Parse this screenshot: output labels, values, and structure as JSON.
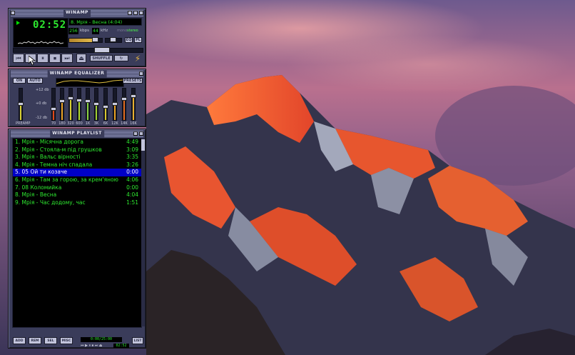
{
  "main": {
    "title": "WINAMP",
    "time": "02:52",
    "song": "8. Мрія - Весна (4:04)",
    "kbps": "256",
    "kbps_unit": "kbps",
    "khz": "44",
    "khz_unit": "kHz",
    "mono": "mono",
    "stereo": "stereo",
    "volume": 0.8,
    "balance": 0.5,
    "seek_position": 0.71,
    "eq_toggle": "EQ",
    "pl_toggle": "PL",
    "shuffle": "SHUFFLE",
    "repeat": "↻",
    "buttons": [
      "⏮",
      "▶",
      "⏸",
      "⏹",
      "⏭",
      "⏏"
    ]
  },
  "equalizer": {
    "title": "WINAMP EQUALIZER",
    "on": "ON",
    "auto": "AUTO",
    "presets": "PRESETS",
    "preamp_label": "PREAMP",
    "db_plus": "+12 db",
    "db_zero": "+0 db",
    "db_minus": "-12 db",
    "bands": [
      "70",
      "180",
      "320",
      "600",
      "1K",
      "3K",
      "6K",
      "12K",
      "14K",
      "16K"
    ],
    "preamp": 0.5,
    "band_levels": [
      0.35,
      0.58,
      0.68,
      0.62,
      0.6,
      0.5,
      0.42,
      0.5,
      0.65,
      0.75
    ]
  },
  "playlist": {
    "title": "WINAMP PLAYLIST",
    "items": [
      {
        "title": "1. Мрія - Місячна дорога",
        "time": "4:49"
      },
      {
        "title": "2. Мрія - Стояла-м під грушков",
        "time": "3:09"
      },
      {
        "title": "3. Мрія - Вальс вірності",
        "time": "3:35"
      },
      {
        "title": "4. Мрія - Темна ніч спадала",
        "time": "3:26"
      },
      {
        "title": "5. 05 Ой ти козаче",
        "time": "0:00"
      },
      {
        "title": "6. Мрія - Там за горою, за крем'яною",
        "time": "4:06"
      },
      {
        "title": "7. 08 Коломийка",
        "time": "0:00"
      },
      {
        "title": "8. Мрія - Весна",
        "time": "4:04"
      },
      {
        "title": "9. Мрія - Час додому, час",
        "time": "1:51"
      }
    ],
    "selected_index": 4,
    "buttons": [
      "ADD",
      "REM",
      "SEL",
      "MISC"
    ],
    "list_button": "LIST",
    "total_time": "0:00/25:00",
    "mini_time": "02:52"
  }
}
